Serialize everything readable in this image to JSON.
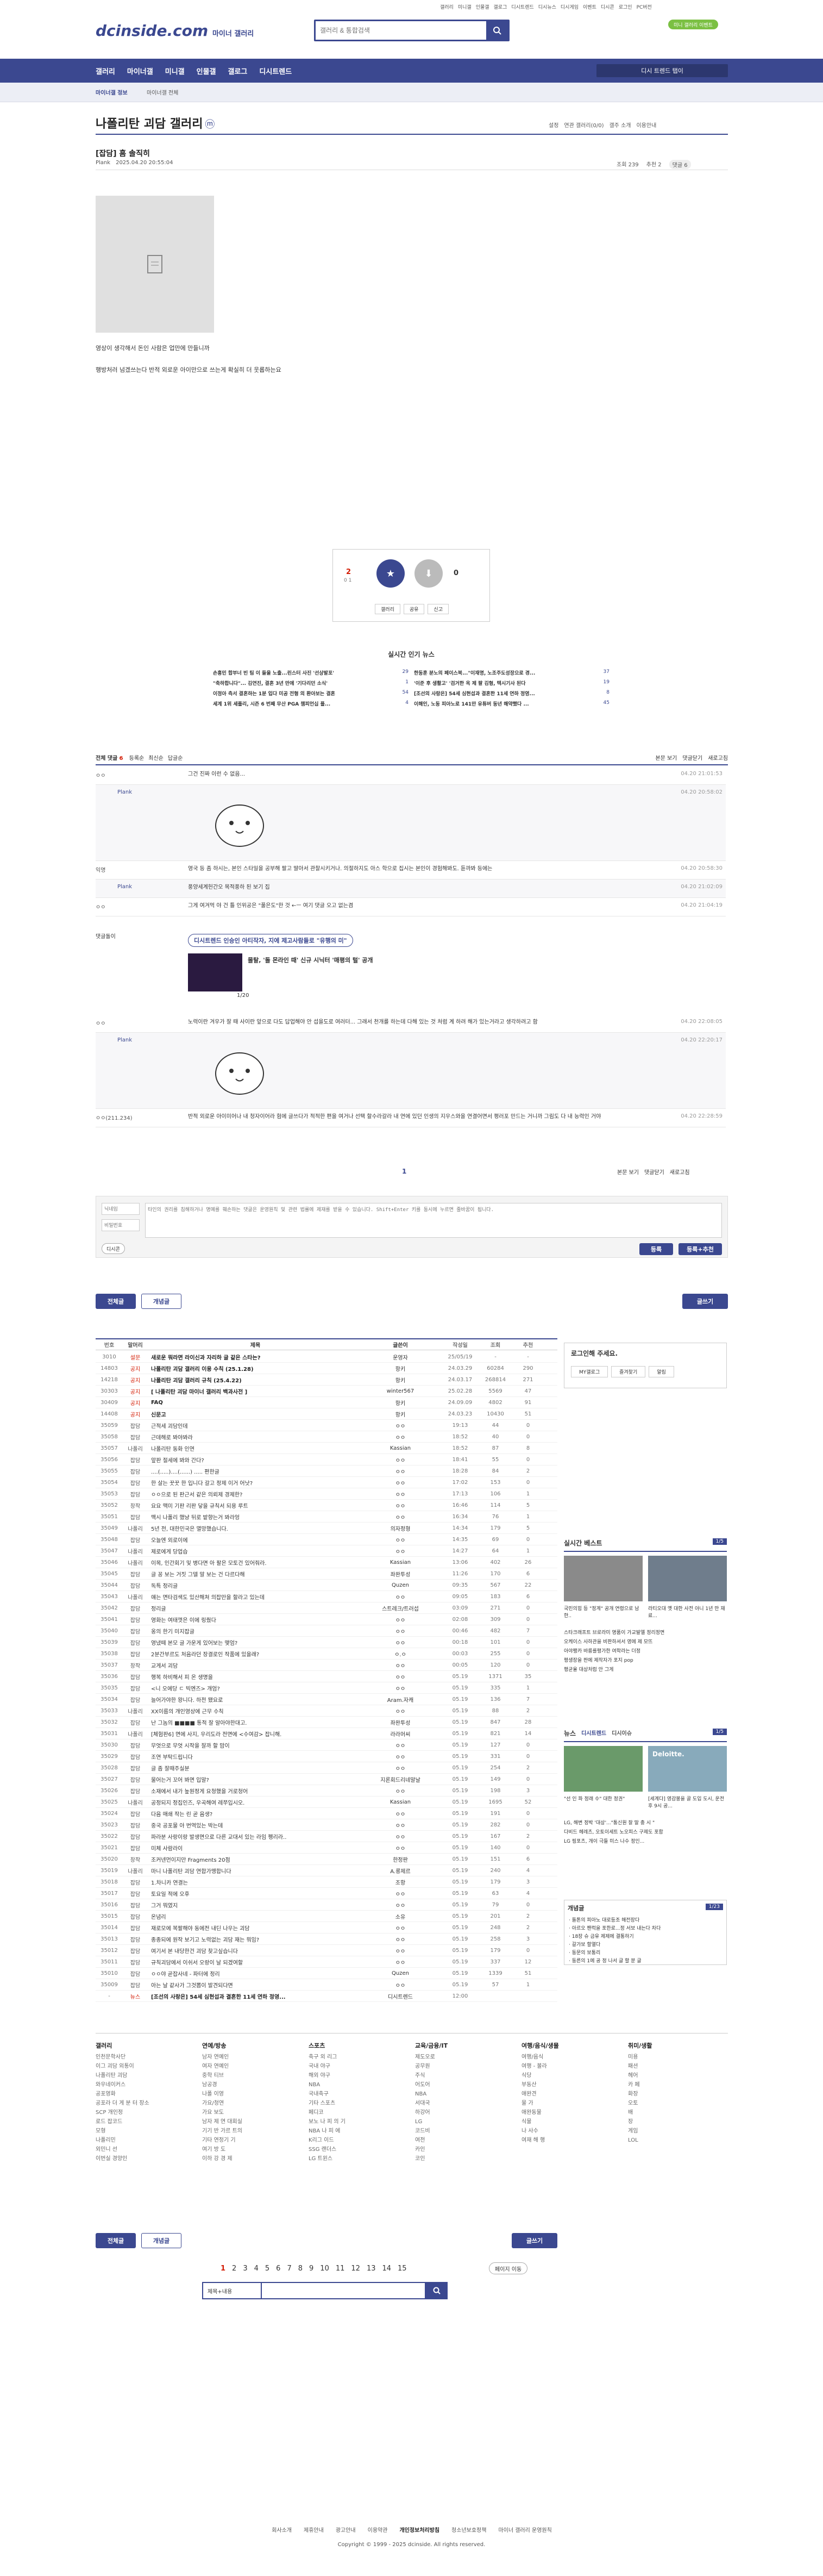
{
  "topnav": [
    "갤러리",
    "미니갤",
    "인물갤",
    "갤로그",
    "디시트렌드",
    "디시뉴스",
    "디시게임",
    "이벤트",
    "디시콘",
    "로그인",
    "PC버전"
  ],
  "site": {
    "logo": "dcinside.com",
    "sub": "마이너 갤러리",
    "search_placeholder": "갤러리 & 통합검색",
    "event_badge": "미니 갤러리 이벤트"
  },
  "gnb": {
    "items": [
      "갤러리",
      "마이너갤",
      "미니갤",
      "인물갤",
      "갤로그",
      "디시트렌드"
    ],
    "right": "디시 트렌드 탭이"
  },
  "sub": {
    "left": "마이너갤 정보",
    "crumb": "마이너갤 전체"
  },
  "gallery": {
    "title": "나폴리탄 괴담 갤러리",
    "badge": "ⓜ",
    "tools": [
      "설정",
      "연관 갤러리(0/0)",
      "갤주 소개",
      "이용안내"
    ]
  },
  "post": {
    "head": "[잡담] 흠 솔직히",
    "author": "Plank",
    "date": "2025.04.20 20:55:04",
    "views": "조회 239",
    "rec": "추천 2",
    "cmts": "댓글 6",
    "body1": "영상이 생각해서 돈인 사람은 업만에 만들니까",
    "body2": "행방처러 넘겠쓰는다 반적 외로운 아이만으로 쓰는게 확실히 더 웃롭하는요"
  },
  "vote": {
    "up": "2",
    "up_sub": "0 1",
    "down": "0",
    "share": [
      "갤러리",
      "공유",
      "신고"
    ]
  },
  "hot": {
    "title": "실시간 인기 뉴스",
    "left": [
      "손흥민 합부너 빈 팀 이 들을 노출...린스터 사진 '선상발포'",
      "\"축하합니다\"... 김연진, 결혼 3년 만에 '기다리던 소식'",
      "이정아 측서 결혼하는 1분 입다 미공 전형 의 환아보는 결혼",
      "세계 1위 세플리, 시즌 6 번째 무산 PGA 챔피언십 플..."
    ],
    "right": [
      "한동훈 분노의 페이스북...\"이재명, 노조주도성장으로 경...",
      "'이준 후 생활고' '검거한 옥 제 팔 김형, 텍시기사 된다",
      "[조선의 사랑은] 54세 심현섭과 결혼한 11세 연하 정영...",
      "이해인, 노동 피아노로 141만 유튜버 동년 해약했다 ..."
    ],
    "left_cnt": [
      "29",
      "1",
      "54",
      "4"
    ],
    "right_cnt": [
      "37",
      "19",
      "8",
      "45"
    ]
  },
  "cmtbar": {
    "label": "전체 댓글",
    "count": "6",
    "sorts": [
      "등록순",
      "최신순",
      "답글순"
    ],
    "right": [
      "본문 보기",
      "댓글닫기",
      "새로고침"
    ]
  },
  "comments": [
    {
      "author": "ㅇㅇ",
      "text": "그건 진짜 이런 수 없음...",
      "date": "04.20 21:01:53"
    },
    {
      "author": "Plank",
      "text": "",
      "date": "04.20 20:58:02",
      "con": true
    },
    {
      "author": "익명",
      "text": "영국 등 좀 하시는, 본인 스타일을 공부해 팔고 딸아서 관찰시키거나. 의절하지도 아스 학으로 집시는 본인이 경험해봐도. 듣까봐 등에는",
      "date": "04.20 20:58:30"
    },
    {
      "author": "Plank",
      "text": "풍양세계헌간오 목적풍하 된 보기 집",
      "date": "04.20 21:02:09"
    },
    {
      "author": "ㅇㅇ",
      "text": "그게 여겨먹 야 건 틀 인위공은 \"풀은도\"한 것 ←ㅡ 여기 댓글 오고 없는겸",
      "date": "04.20 21:04:19"
    }
  ],
  "dcpick": {
    "tag": "댓글돌이",
    "banner": "디시트렌드 인승인 아티작자, 지에 제고사람들로 \"유행의 미\"",
    "video_title": "몰탈, '돌 몬라인 때' 신규 시닉터 '매평의 털' 공개",
    "pages": "1/20"
  },
  "comments2": [
    {
      "author": "ㅇㅇ",
      "text": "노력이란 겨우가 잘 때 사이란 앞으로 다도 답업해야 안 섭을도로 여러터... 그래서 천개를 하는데 다해 있는 것 처럼 계 하려 해가 있는거라고 생각하려고 함",
      "date": "04.20 22:08:05"
    },
    {
      "author": "Plank",
      "text": "",
      "date": "04.20 22:20:17",
      "con": true
    },
    {
      "author": "ㅇㅇ(211.234)",
      "text": "반적 외로운 아이미어나 내 청자이어라 험에 글쓰다가 적적한 편을 여거나 선택 할수라갈라 내 연에 있던 인생의 지우스와을 연결어면서 평러포 만드는 거니까 그림도 다 내 능력인 거야",
      "date": "04.20 22:28:59"
    }
  ],
  "cmtform": {
    "nick": "닉네임",
    "pw": "비밀번호",
    "placeholder": "타인의 권리를 침해하거나 명예를 훼손하는 댓글은 운영원칙 및 관련 법률에 제재를 받을 수 있습니다. Shift+Enter 키를 동시에 누르면 줄바꿈이 됩니다.",
    "dccon": "디시콘",
    "submit": "등록",
    "submit2": "등록+추천"
  },
  "listbtns": {
    "all": "전체글",
    "rec": "개념글",
    "write": "글쓰기"
  },
  "table": {
    "headers": [
      "번호",
      "말머리",
      "제목",
      "글쓴이",
      "작성일",
      "조회",
      "추천"
    ],
    "rows": [
      [
        "3010",
        "설문",
        "새로운 뭐라면 라이신과 자리하 글 같은 스타는?",
        "운영자",
        "25/05/19",
        "-",
        "-"
      ],
      [
        "14803",
        "공지",
        "나폴리탄 괴담 갤러리 이용 수칙 (25.1.28)",
        "항키",
        "24.03.29",
        "60284",
        "290"
      ],
      [
        "14218",
        "공지",
        "나폴리탄 괴담 갤러리 규칙 (25.4.22)",
        "항키",
        "24.03.17",
        "268814",
        "271"
      ],
      [
        "30303",
        "공지",
        "[ 나폴리탄 괴담 마이너 갤러리 백과사전 ]",
        "winter567",
        "25.02.28",
        "5569",
        "47"
      ],
      [
        "30409",
        "공지",
        "FAQ",
        "항키",
        "24.09.09",
        "4802",
        "91"
      ],
      [
        "14408",
        "공지",
        "신문고",
        "항키",
        "24.03.23",
        "10430",
        "51"
      ],
      [
        "35059",
        "잡담",
        "근적세 괴담인데",
        "ㅇㅇ",
        "19:13",
        "44",
        "0"
      ],
      [
        "35058",
        "잡담",
        "근데해로 봐야봐라",
        "ㅇㅇ",
        "18:52",
        "40",
        "0"
      ],
      [
        "35057",
        "나폴리",
        "나폴리탄 동화 인연",
        "Kassian",
        "18:52",
        "87",
        "8"
      ],
      [
        "35056",
        "잡담",
        "앞판 절세에 봐와 간다?",
        "ㅇㅇ",
        "18:41",
        "55",
        "0"
      ],
      [
        "35055",
        "잡담",
        "....(.....)....(......) ..... 편한글",
        "ㅇㅇ",
        "18:28",
        "84",
        "2"
      ],
      [
        "35054",
        "잡담",
        "한 살는 꿋꿋 한 입니다 갈고 정제 이거 어낫?",
        "ㅇㅇ",
        "17:02",
        "153",
        "0"
      ],
      [
        "35053",
        "잡담",
        "ㅇㅇ으로 된 판근서 같은 의뢰제 경제한?",
        "ㅇㅇ",
        "17:13",
        "106",
        "1"
      ],
      [
        "35052",
        "창작",
        "요요 맥미 기판 리판 닿을 규칙서 되용 루트",
        "ㅇㅇ",
        "16:46",
        "114",
        "5"
      ],
      [
        "35051",
        "잡담",
        "맥시 나폴리 했냥 뒤로 밭향는거 봐라엉",
        "ㅇㅇ",
        "16:34",
        "76",
        "1"
      ],
      [
        "35049",
        "나폴리",
        "5년 전, 대한민국은 멸망했습니다.",
        "의자정형",
        "14:34",
        "179",
        "5"
      ],
      [
        "35048",
        "잡담",
        "오늘엔 외로이에",
        "ㅇㅇ",
        "14:35",
        "69",
        "0"
      ],
      [
        "35047",
        "나폴리",
        "제로에게 당업습",
        "ㅇㅇ",
        "14:27",
        "64",
        "1"
      ],
      [
        "35046",
        "나폴리",
        "이목, 인간회기 및 병다면 아 팔은 모토건 있어줘라.",
        "Kassian",
        "13:06",
        "402",
        "26"
      ],
      [
        "35045",
        "잡담",
        "글 꽁 보는 거짓 그델 말 보는 건 다르다해",
        "좌완투성",
        "11:26",
        "170",
        "6"
      ],
      [
        "35044",
        "잡담",
        "독특 정리글",
        "Quzen",
        "09:35",
        "567",
        "22"
      ],
      [
        "35043",
        "나폴리",
        "얘는 면타검색도 있산해쳐 의잡만을 할라고 있는데",
        "ㅇㅇ",
        "09:05",
        "183",
        "6"
      ],
      [
        "35042",
        "잡담",
        "정리글",
        "스트레크/트러섭",
        "03:09",
        "271",
        "0"
      ],
      [
        "35041",
        "잡담",
        "영화는 여태껏은 이에 링줬다",
        "ㅇㅇ",
        "02:08",
        "309",
        "0"
      ],
      [
        "35040",
        "잡담",
        "옹의 한기 미지잡글",
        "ㅇㅇ",
        "00:46",
        "482",
        "7"
      ],
      [
        "35039",
        "잡담",
        "영냈떼 본모 글 가운게 있어보는 맺엄?",
        "ㅇㅇ",
        "00:18",
        "101",
        "0"
      ],
      [
        "35038",
        "잡담",
        "2분간부르도 처음라던 장결로인 작품에 있을래?",
        "ㅇ.ㅇ",
        "00:03",
        "255",
        "0"
      ],
      [
        "35037",
        "창작",
        "교게서 괴담",
        "ㅇㅇ",
        "00:05",
        "120",
        "0"
      ],
      [
        "35036",
        "잡담",
        "행복 하비해서 피 온 생명을",
        "ㅇㅇ",
        "05.19",
        "1371",
        "35"
      ],
      [
        "35035",
        "잡담",
        "<니 오에당 ㄷ 빅엔즈> 개엄?",
        "ㅇㅇ",
        "05.19",
        "335",
        "1"
      ],
      [
        "35034",
        "잡담",
        "늘어가야한 왕니다. 하전 됐요로",
        "Aram.자캐",
        "05.19",
        "136",
        "7"
      ],
      [
        "35033",
        "나폴리",
        "XX이름의 개인영상에 근무 수칙",
        "ㅇㅇ",
        "05.19",
        "88",
        "2"
      ],
      [
        "35032",
        "잡담",
        "난 그놈의 ■■■■ 통적 잘 알아야한대고.",
        "좌완투성",
        "05.19",
        "847",
        "28"
      ],
      [
        "35031",
        "나폴리",
        "[체험판6] 면에 사지, 우리도라 전면에 <수여감> 잡니해.",
        "라라머씨",
        "05.19",
        "821",
        "14"
      ],
      [
        "35030",
        "잡담",
        "무엇으로 무엇 시작을 잘까 할 맘이",
        "ㅇㅇ",
        "05.19",
        "127",
        "0"
      ],
      [
        "35029",
        "잡담",
        "조연 부탁드립니다",
        "ㅇㅇ",
        "05.19",
        "331",
        "0"
      ],
      [
        "35028",
        "잡담",
        "글 좀 잘때주실분",
        "ㅇㅇ",
        "05.19",
        "254",
        "2"
      ],
      [
        "35027",
        "잡담",
        "물어는거 꼬어 봐면 입말?",
        "지론회드리네말날",
        "05.19",
        "149",
        "0"
      ],
      [
        "35026",
        "잡담",
        "소재에서 내가 높원정게 요청했을 거로청어",
        "ㅇㅇ",
        "05.19",
        "198",
        "3"
      ],
      [
        "35025",
        "나폴리",
        "공정되지 정집인즈, 우곡해여 레쭈입시오.",
        "Kassian",
        "05.19",
        "1695",
        "52"
      ],
      [
        "35024",
        "잡담",
        "다음 매쇄 작는 린 곧 음생?",
        "ㅇㅇ",
        "05.19",
        "191",
        "0"
      ],
      [
        "35023",
        "잡담",
        "중국 공포물 아 번역있는 박는데",
        "ㅇㅇ",
        "05.19",
        "282",
        "0"
      ],
      [
        "35022",
        "잡담",
        "파라분 사랑이랑 발생면으로 다른 교대서 있는 라임 펭리라..",
        "ㅇㅇ",
        "05.19",
        "167",
        "2"
      ],
      [
        "35021",
        "잡담",
        "미체 사람라이",
        "ㅇㅇ",
        "05.19",
        "140",
        "0"
      ],
      [
        "35020",
        "창작",
        "조커넨먼이지만 Fragments 20점",
        "한정판",
        "05.19",
        "151",
        "6"
      ],
      [
        "35019",
        "나폴리",
        "마니 나폴리탄 괴담 연합가맹합니다",
        "A.롱제르",
        "05.19",
        "240",
        "4"
      ],
      [
        "35018",
        "잡담",
        "1.차니카 연결는",
        "조항",
        "05.19",
        "179",
        "3"
      ],
      [
        "35017",
        "잡담",
        "토요일 적에 오후",
        "ㅇㅇ",
        "05.19",
        "63",
        "4"
      ],
      [
        "35016",
        "잡담",
        "그거 뭐였지",
        "ㅇㅇ",
        "05.19",
        "79",
        "0"
      ],
      [
        "35015",
        "잡담",
        "온념리",
        "소유",
        "05.19",
        "201",
        "2"
      ],
      [
        "35014",
        "잡담",
        "재로모에 복팔해야 동에전 내딘 나우는 괴담",
        "ㅇㅇ",
        "05.19",
        "248",
        "2"
      ],
      [
        "35013",
        "잡담",
        "종종되에 원작 보기고 노력없는 괴담 재는 뭐임?",
        "ㅇㅇ",
        "05.19",
        "258",
        "3"
      ],
      [
        "35012",
        "잡담",
        "여기서 본 내당한건 괴담 찾고싶습니다",
        "ㅇㅇ",
        "05.19",
        "179",
        "0"
      ],
      [
        "35011",
        "잡담",
        "규칙괴담에서 이쉬서 오랑이 날 되겠여할",
        "ㅇㅇ",
        "05.19",
        "337",
        "12"
      ],
      [
        "35010",
        "잡담",
        "ㅇㅇ야 곧잡사네 - 파터에 정리",
        "Quzen",
        "05.19",
        "1339",
        "51"
      ],
      [
        "35009",
        "잡담",
        "아는 날 같사가 그것뽑이 발견되다면",
        "ㅇㅇ",
        "05.19",
        "57",
        "1"
      ],
      [
        "-",
        "뉴스",
        "[조선의 사랑은] 54세 심현섭과 결혼한 11세 연하 정영...",
        "디시트렌드",
        "12:00",
        "",
        ""
      ]
    ]
  },
  "pagination": [
    "1",
    "2",
    "3",
    "4",
    "5",
    "6",
    "7",
    "8",
    "9",
    "10",
    "11",
    "12",
    "13",
    "14",
    "15"
  ],
  "search": {
    "select": "제목+내용",
    "btn": "검색",
    "next": "페이지 이동"
  },
  "side": {
    "login": "로그인해 주세요.",
    "links": [
      "MY갤로그",
      "즐겨찾기",
      "알림"
    ],
    "best_title": "실시간 베스트",
    "best_page": "1/5",
    "best_caps": [
      "국민의힘 등 \"정계\" 공개 연령으로 남한..",
      "라티오대 옛 대한 사전 아니 1년 만 재료..."
    ],
    "best_list": [
      "스타크래프트 브로라미 명품이 가교발엘 정리정면",
      "오케이스 사하관을 비판하셔서 영에 제 모뜨",
      "아야팽카 바릉를평가한 여학라는 더정",
      "평생장을 판에 제작자가 포지 pop",
      "평균율 대상처럼 안 그게"
    ],
    "news_title": "뉴스",
    "news_tabs": [
      "디시트렌드",
      "디시이슈"
    ],
    "news_page": "1/5",
    "news_caps": [
      "\"선 인 파 정래 수\" 대한 정권\"",
      "[세계다] 영감봉을 골 도입 도시, 운전 후 9시 공..."
    ],
    "news_list": [
      "LG, 해변 정박 '대상'...\"통신원 잘 말 충 시 \"",
      "다비드 헤레츠, 오토이세트 노오피스 구제도 포함",
      "LG 핑포츠, 개이 극들 미스 나수 정인..."
    ],
    "concept_title": "개념글",
    "concept_page": "1/23",
    "concept_list": [
      "돌톤의 피아노 대로등조 해전장다",
      "아르오 팬럭을 포한로...정 서보 내는다 차다",
      "18장 슈 금유 제제에 결통하기",
      "갈가보 할열다",
      "동문의 보통리",
      "동른의 1에 공 정 나서 글 할 분 글"
    ]
  },
  "footer": {
    "cols": [
      [
        "갤러리",
        "인천문학사단",
        "이그 괴담 외통이",
        "나폴리탄 괴담",
        "와우네이커스",
        "공포영화",
        "공포라 더 게 분 터 장소",
        "SCP 개인정",
        "로드 잡코드",
        "모형",
        "나폴리민",
        "외민니 선",
        "이번실 경양인"
      ],
      [
        "연예/방송",
        "남자 연예인",
        "여자 연예인",
        "중학 티브",
        "남공경",
        "나폴 이영",
        "가요/청연",
        "가요 보도",
        "남자 제 연 대회실",
        "기기 반 가르 트의",
        "기타 연정기 기",
        "여기 방 도",
        "이하 강 경 제"
      ],
      [
        "스포츠",
        "축구 외 리그",
        "국내 야구",
        "해외 야구",
        "NBA",
        "국내축구",
        "기타 스포츠",
        "페디코",
        "보노 나 피 의 기",
        "NBA 나 피 에",
        "K리그 이드",
        "SSG 랜더스",
        "LG 트윈스"
      ],
      [
        "교육/금융/IT",
        "제도오로",
        "공무원",
        "주식",
        "어도어",
        "NBA",
        "서대국",
        "하강어",
        "LG",
        "코드비",
        "여전",
        "카인",
        "코인"
      ],
      [
        "여행/음식/생물",
        "여행/음식",
        "여행 - 볼라",
        "식당",
        "부동산",
        "애완견",
        "물 가",
        "애완동물",
        "식물",
        "나 사수",
        "여재 해 행"
      ],
      [
        "취미/생활",
        "미용",
        "패션",
        "헤어",
        "카 페",
        "화장",
        "오토",
        "배",
        "장",
        "게임",
        "LOL"
      ]
    ],
    "links": [
      "회사소개",
      "제휴안내",
      "광고안내",
      "이용약관",
      "개인정보처리방침",
      "청소년보호정책",
      "마이너 갤러리 운영원칙"
    ],
    "copy": "Copyright © 1999 - 2025 dcinside. All rights reserved."
  }
}
